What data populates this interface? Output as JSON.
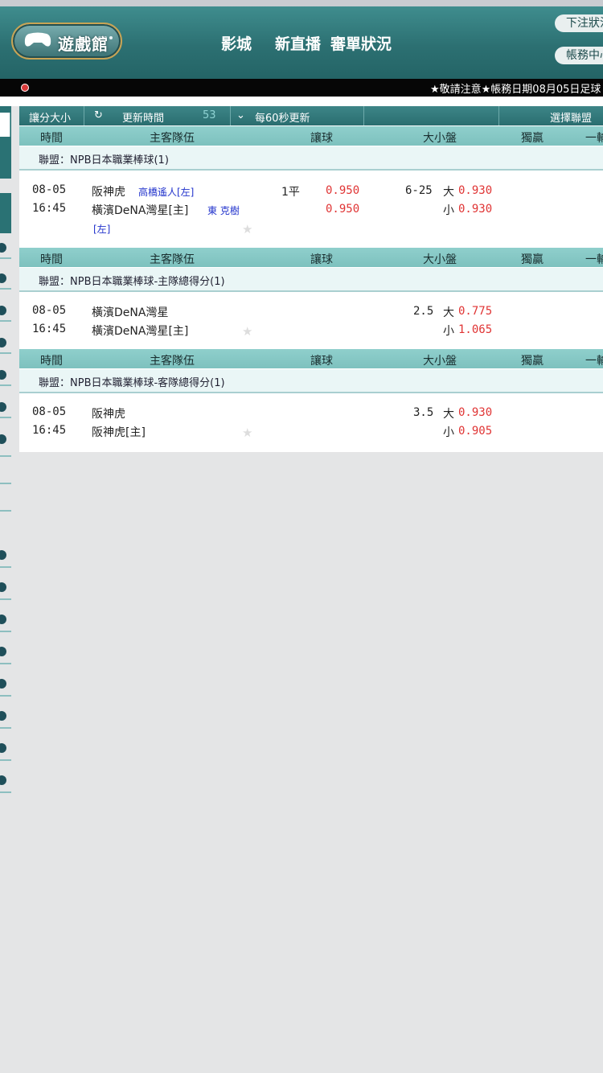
{
  "header": {
    "logo_label": "遊戲館",
    "nav": [
      "影城",
      "新直播",
      "審單狀況"
    ],
    "right_buttons": [
      "下注狀況",
      "帳務中心"
    ]
  },
  "ticker": {
    "text": "★敬請注意★帳務日期08月05日足球"
  },
  "toolbar": {
    "handicap_size": "讓分大小",
    "refresh_icon": "refresh-icon",
    "update_time_label": "更新時間",
    "countdown": "53",
    "interval": "每60秒更新",
    "select_league": "選擇聯盟"
  },
  "columns": [
    "時間",
    "主客隊伍",
    "讓球",
    "大小盤",
    "獨贏",
    "一輸"
  ],
  "sections": [
    {
      "league": "聯盟：NPB日本職業棒球(1)",
      "match": {
        "date": "08-05",
        "time": "16:45",
        "home": "阪神虎",
        "home_pitcher": "高橋遙人[左]",
        "away": "橫濱DeNA灣星[主]",
        "away_pitcher": "東 克樹",
        "away_pitcher_hand": "[左]",
        "handicap_line": "1平",
        "handicap_odds": [
          "0.950",
          "0.950"
        ],
        "ou_line": "6-25",
        "ou_labels": [
          "大",
          "小"
        ],
        "ou_odds": [
          "0.930",
          "0.930"
        ]
      }
    },
    {
      "league": "聯盟：NPB日本職業棒球-主隊總得分(1)",
      "match": {
        "date": "08-05",
        "time": "16:45",
        "home": "橫濱DeNA灣星",
        "away": "橫濱DeNA灣星[主]",
        "ou_line": "2.5",
        "ou_labels": [
          "大",
          "小"
        ],
        "ou_odds": [
          "0.775",
          "1.065"
        ]
      }
    },
    {
      "league": "聯盟：NPB日本職業棒球-客隊總得分(1)",
      "match": {
        "date": "08-05",
        "time": "16:45",
        "home": "阪神虎",
        "away": "阪神虎[主]",
        "ou_line": "3.5",
        "ou_labels": [
          "大",
          "小"
        ],
        "ou_odds": [
          "0.930",
          "0.905"
        ]
      }
    }
  ]
}
